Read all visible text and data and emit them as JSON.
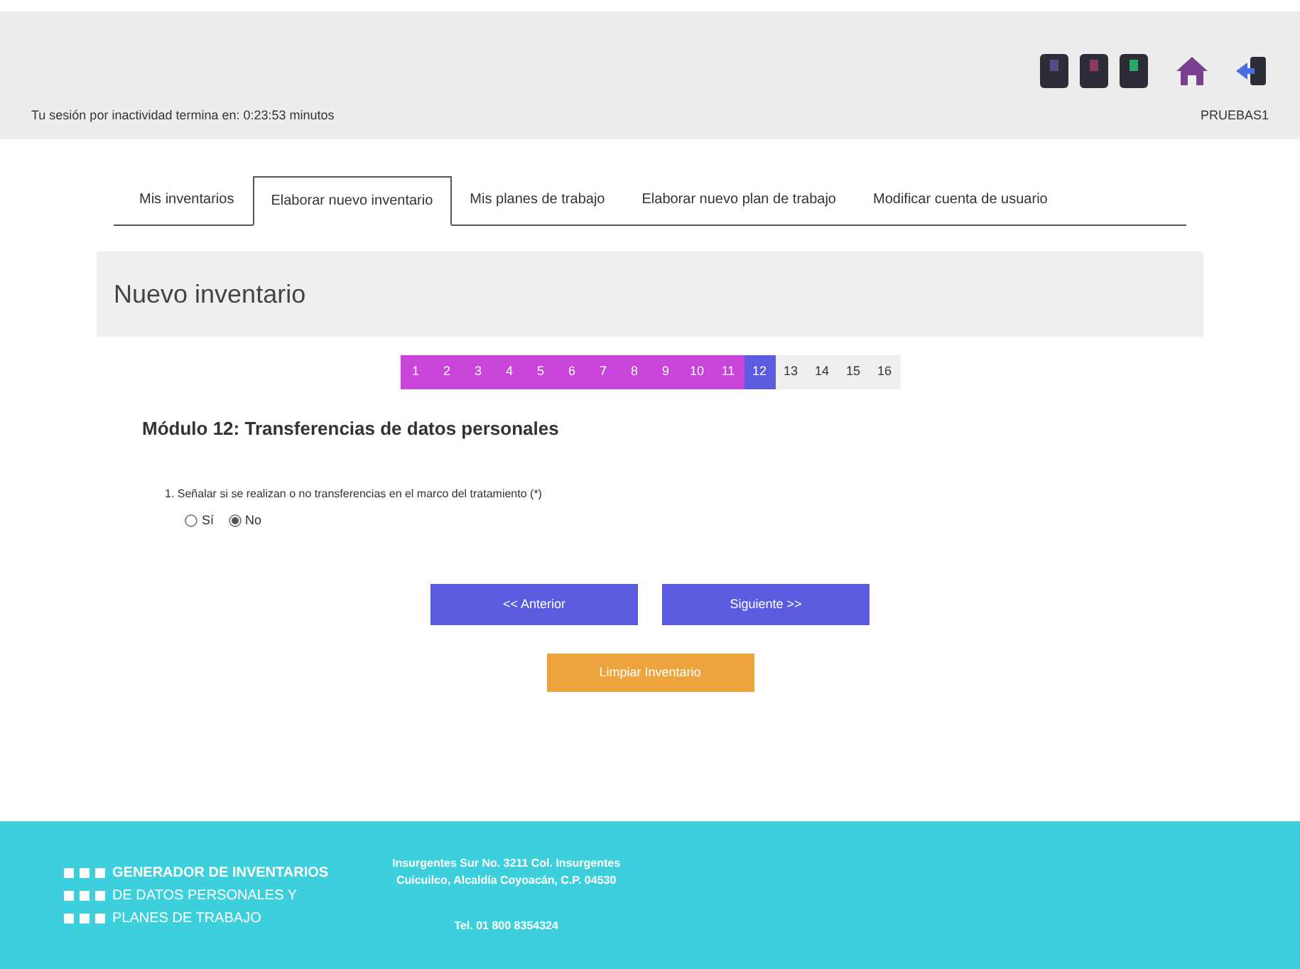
{
  "header": {
    "session_text": "Tu sesión por inactividad termina en: 0:23:53 minutos",
    "user": "PRUEBAS1"
  },
  "tabs": [
    {
      "label": "Mis inventarios",
      "selected": false
    },
    {
      "label": "Elaborar nuevo inventario",
      "selected": true
    },
    {
      "label": "Mis planes de trabajo",
      "selected": false
    },
    {
      "label": "Elaborar nuevo plan de trabajo",
      "selected": false
    },
    {
      "label": "Modificar cuenta de usuario",
      "selected": false
    }
  ],
  "panel_title": "Nuevo inventario",
  "steps": [
    {
      "label": "1",
      "completed": true,
      "selected": false
    },
    {
      "label": "2",
      "completed": true,
      "selected": false
    },
    {
      "label": "3",
      "completed": true,
      "selected": false
    },
    {
      "label": "4",
      "completed": true,
      "selected": false
    },
    {
      "label": "5",
      "completed": true,
      "selected": false
    },
    {
      "label": "6",
      "completed": true,
      "selected": false
    },
    {
      "label": "7",
      "completed": true,
      "selected": false
    },
    {
      "label": "8",
      "completed": true,
      "selected": false
    },
    {
      "label": "9",
      "completed": true,
      "selected": false
    },
    {
      "label": "10",
      "completed": true,
      "selected": false
    },
    {
      "label": "11",
      "completed": true,
      "selected": false
    },
    {
      "label": "12",
      "completed": false,
      "selected": true
    },
    {
      "label": "13",
      "completed": false,
      "selected": false
    },
    {
      "label": "14",
      "completed": false,
      "selected": false
    },
    {
      "label": "15",
      "completed": false,
      "selected": false
    },
    {
      "label": "16",
      "completed": false,
      "selected": false
    }
  ],
  "module_title": "Módulo 12: Transferencias de datos personales",
  "question": {
    "text": "1. Señalar si se realizan o no transferencias en el marco del tratamiento (*)",
    "options": [
      {
        "label": "Sí",
        "selected": false
      },
      {
        "label": "No",
        "selected": true
      }
    ]
  },
  "buttons": {
    "previous": "<< Anterior",
    "next": "Siguiente >>",
    "clear": "Limpiar Inventario"
  },
  "footer": {
    "brand": [
      "GENERADOR DE INVENTARIOS",
      "DE DATOS PERSONALES Y",
      "PLANES DE TRABAJO"
    ],
    "address": [
      "Insurgentes Sur No. 3211 Col. Insurgentes",
      "Cuicuilco, Alcaldía Coyoacán, C.P. 04530"
    ],
    "phone": "Tel. 01 800 8354324"
  }
}
